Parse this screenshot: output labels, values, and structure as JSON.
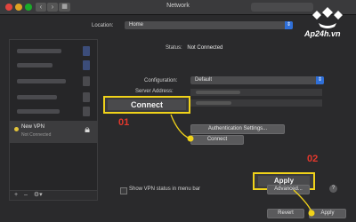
{
  "window": {
    "title": "Network"
  },
  "location": {
    "label": "Location:",
    "value": "Home"
  },
  "sidebar": {
    "vpn": {
      "name": "New VPN",
      "status": "Not Connected"
    },
    "footer": [
      "+",
      "–",
      "⚙▾"
    ]
  },
  "status": {
    "label": "Status:",
    "value": "Not Connected"
  },
  "configuration": {
    "label": "Configuration:",
    "value": "Default"
  },
  "server": {
    "label": "Server Address:"
  },
  "buttons": {
    "connect_big": "Connect",
    "auth_settings": "Authentication Settings...",
    "connect_small": "Connect",
    "apply_big": "Apply",
    "advanced": "Advanced...",
    "help": "?",
    "revert": "Revert",
    "apply_small": "Apply"
  },
  "checkbox": {
    "label": "Show VPN status in menu bar"
  },
  "annotations": {
    "step1": "01",
    "step2": "02",
    "accent": "#f0d21a",
    "step_color": "#e4382c"
  },
  "watermark": {
    "text": "Ap24h.vn"
  }
}
